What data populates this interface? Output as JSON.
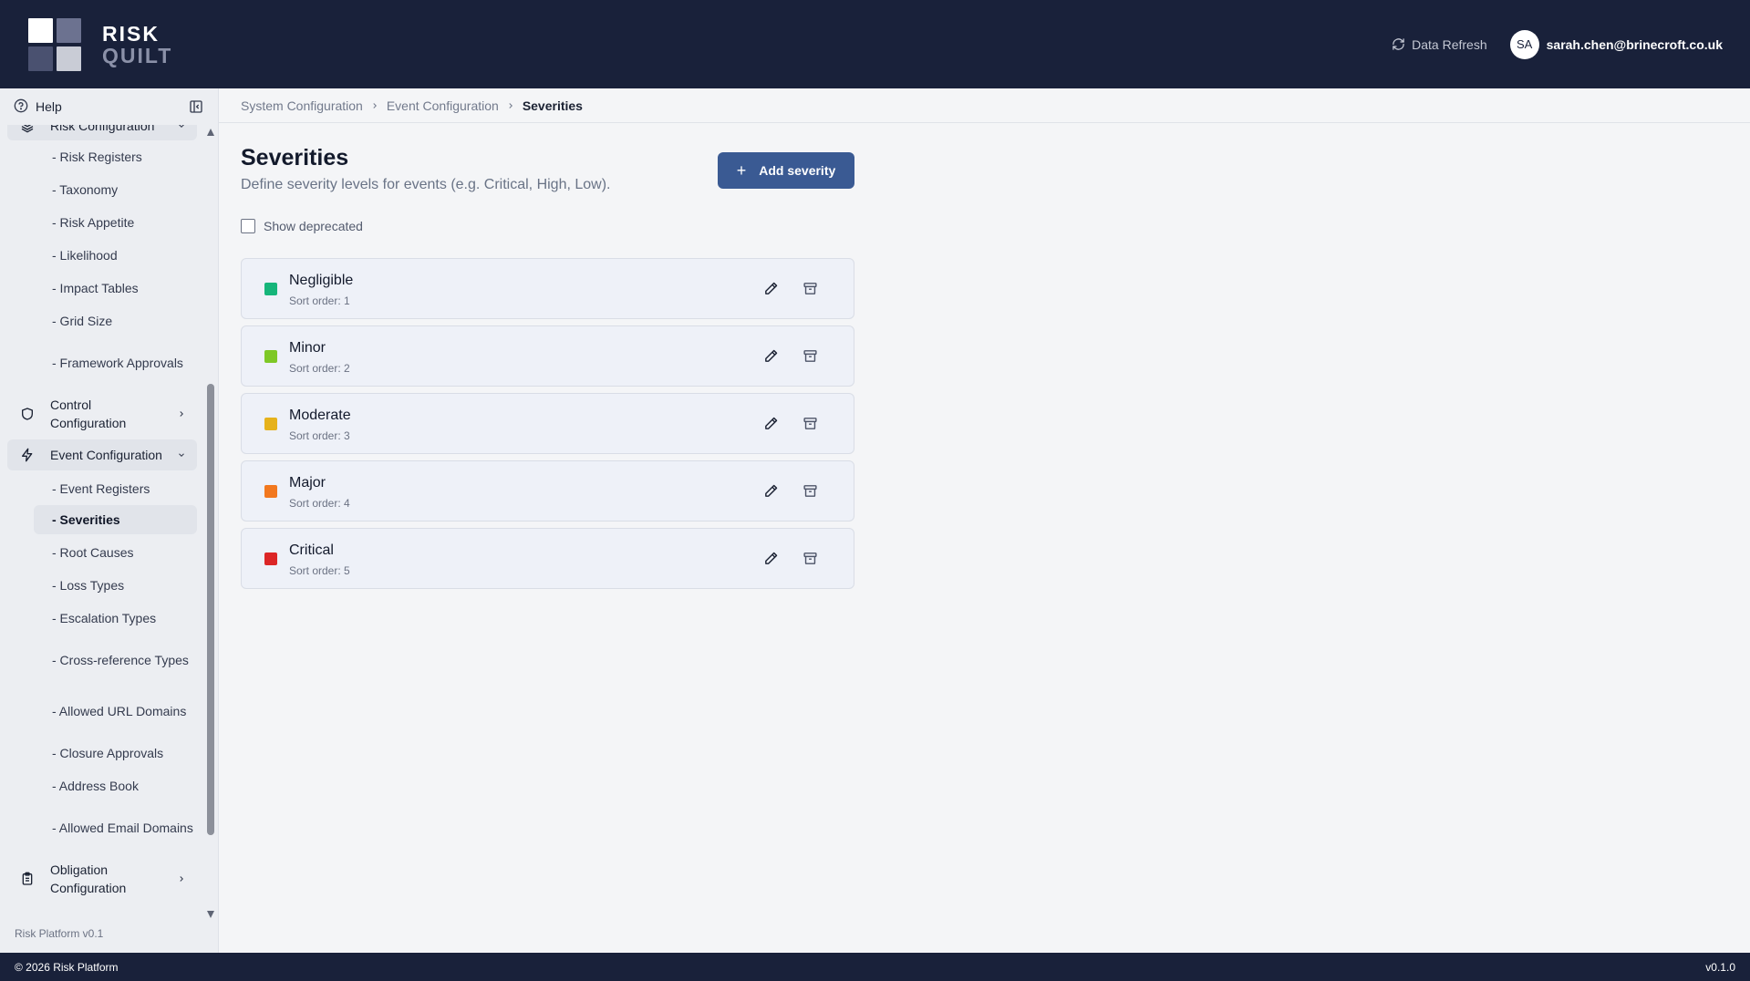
{
  "brand": {
    "line1": "RISK",
    "line2": "QUILT"
  },
  "header": {
    "refresh_label": "Data Refresh",
    "avatar_initials": "SA",
    "user_email": "sarah.chen@brinecroft.co.uk"
  },
  "sidebar": {
    "help_label": "Help",
    "risk_group": {
      "label": "Risk Configuration",
      "items": [
        "- Risk Registers",
        "- Taxonomy",
        "- Risk Appetite",
        "- Likelihood",
        "- Impact Tables",
        "- Grid Size",
        "- Framework Approvals"
      ]
    },
    "control_group": {
      "label": "Control Configuration"
    },
    "event_group": {
      "label": "Event Configuration",
      "items": [
        "- Event Registers",
        "- Severities",
        "- Root Causes",
        "- Loss Types",
        "- Escalation Types",
        "- Cross-reference Types",
        "- Allowed URL Domains",
        "- Closure Approvals",
        "- Address Book",
        "- Allowed Email Domains"
      ]
    },
    "obligation_group": {
      "label": "Obligation Configuration"
    },
    "version": "Risk Platform v0.1"
  },
  "breadcrumb": [
    "System Configuration",
    "Event Configuration",
    "Severities"
  ],
  "page": {
    "title": "Severities",
    "description": "Define severity levels for events (e.g. Critical, High, Low).",
    "add_button": "Add severity",
    "add_icon": "+",
    "show_deprecated_label": "Show deprecated",
    "show_deprecated_checked": false
  },
  "severities": [
    {
      "name": "Negligible",
      "sort_label": "Sort order: 1",
      "color": "#16b57a"
    },
    {
      "name": "Minor",
      "sort_label": "Sort order: 2",
      "color": "#7ec826"
    },
    {
      "name": "Moderate",
      "sort_label": "Sort order: 3",
      "color": "#e6b21b"
    },
    {
      "name": "Major",
      "sort_label": "Sort order: 4",
      "color": "#f2781e"
    },
    {
      "name": "Critical",
      "sort_label": "Sort order: 5",
      "color": "#dc2626"
    }
  ],
  "footer": {
    "copyright": "© 2026 Risk Platform",
    "version": "v0.1.0"
  },
  "colors": {
    "header_bg": "#19213a",
    "primary_button": "#3a5a93",
    "card_bg": "#eef1f8"
  }
}
